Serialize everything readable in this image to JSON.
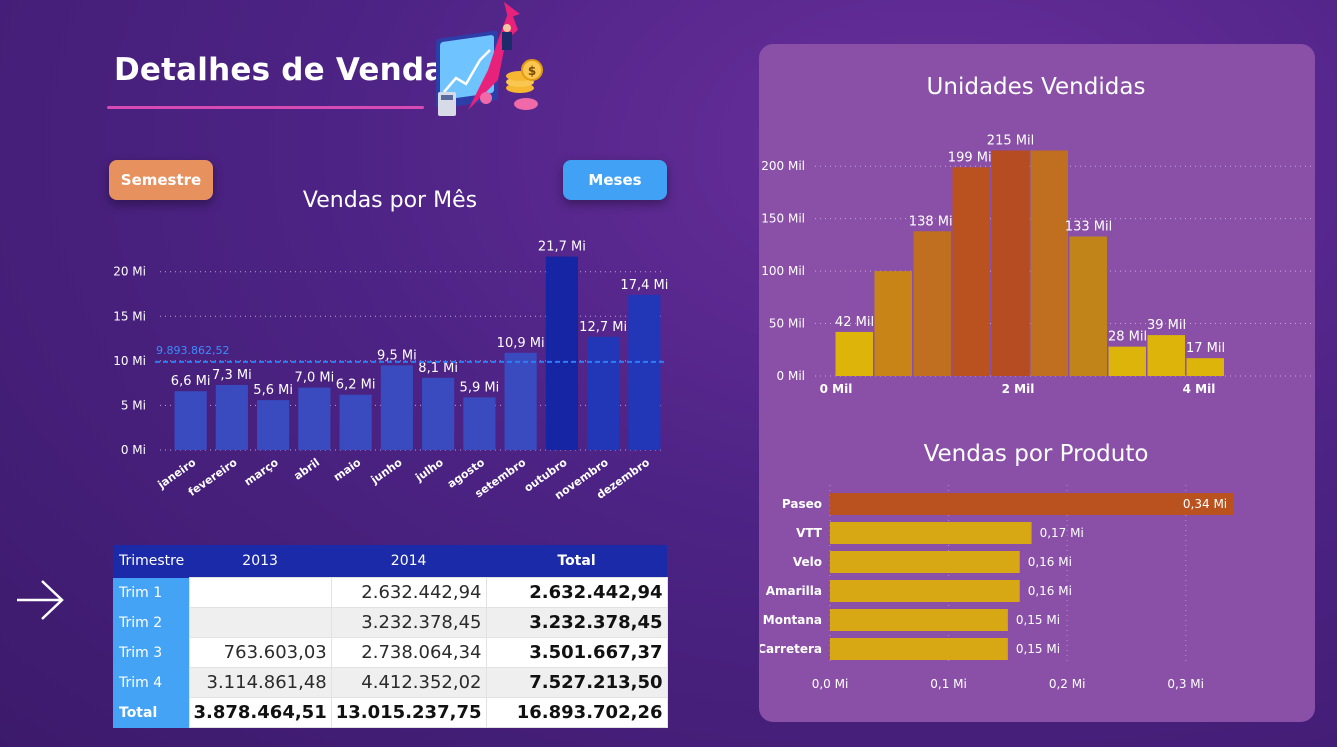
{
  "header": {
    "title": "Detalhes de Vendas"
  },
  "buttons": {
    "semestre": "Semestre",
    "meses": "Meses"
  },
  "charts": {
    "vendas_mes_title": "Vendas por Mês",
    "unidades_title": "Unidades Vendidas",
    "produto_title": "Vendas por Produto"
  },
  "colors": {
    "accent_bar": "#3a4abf",
    "highlight_bar": "#1525a3",
    "avg_line": "#2b7df5",
    "button_semestre": "#e7915f",
    "button_meses": "#41a2f5",
    "panel": "#8a50a8"
  },
  "chart_data": [
    {
      "id": "vendas_por_mes",
      "type": "bar",
      "title": "Vendas por Mês",
      "categories": [
        "janeiro",
        "fevereiro",
        "março",
        "abril",
        "maio",
        "junho",
        "julho",
        "agosto",
        "setembro",
        "outubro",
        "novembro",
        "dezembro"
      ],
      "values": [
        6.6,
        7.3,
        5.6,
        7.0,
        6.2,
        9.5,
        8.1,
        5.9,
        10.9,
        21.7,
        12.7,
        17.4
      ],
      "labels": [
        "6,6 Mi",
        "7,3 Mi",
        "5,6 Mi",
        "7,0 Mi",
        "6,2 Mi",
        "9,5 Mi",
        "8,1 Mi",
        "5,9 Mi",
        "10,9 Mi",
        "21,7 Mi",
        "12,7 Mi",
        "17,4 Mi"
      ],
      "unit": "Mi",
      "yticks": [
        "0 Mi",
        "5 Mi",
        "10 Mi",
        "15 Mi",
        "20 Mi"
      ],
      "ylim": [
        0,
        23
      ],
      "average_line": {
        "value": 9.89386252,
        "label": "9.893.862,52"
      },
      "grid": true
    },
    {
      "id": "unidades_vendidas",
      "type": "bar",
      "title": "Unidades Vendidas",
      "values": [
        42,
        100,
        138,
        199,
        215,
        215,
        133,
        28,
        39,
        17
      ],
      "labels": [
        "42 Mil",
        "",
        "138 Mil",
        "199 Mil",
        "215 Mil",
        "",
        "133 Mil",
        "28 Mil",
        "39 Mil",
        "17 Mil"
      ],
      "yticks": [
        "0 Mil",
        "50 Mil",
        "100 Mil",
        "150 Mil",
        "200 Mil"
      ],
      "xticks": [
        "0 Mil",
        "2 Mil",
        "4 Mil"
      ],
      "ylim": [
        0,
        225
      ],
      "grid": true
    },
    {
      "id": "vendas_por_produto",
      "type": "bar",
      "orientation": "horizontal",
      "title": "Vendas por Produto",
      "categories": [
        "Paseo",
        "VTT",
        "Velo",
        "Amarilla",
        "Montana",
        "Carretera"
      ],
      "values": [
        0.34,
        0.17,
        0.16,
        0.16,
        0.15,
        0.15
      ],
      "labels": [
        "0,34 Mi",
        "0,17 Mi",
        "0,16 Mi",
        "0,16 Mi",
        "0,15 Mi",
        "0,15 Mi"
      ],
      "xticks": [
        "0,0 Mi",
        "0,1 Mi",
        "0,2 Mi",
        "0,3 Mi"
      ],
      "xlim": [
        0,
        0.35
      ],
      "grid": true
    }
  ],
  "matrix": {
    "headers": [
      "Trimestre",
      "2013",
      "2014",
      "Total"
    ],
    "rows": [
      {
        "label": "Trim 1",
        "v2013": "",
        "v2014": "2.632.442,94",
        "total": "2.632.442,94"
      },
      {
        "label": "Trim 2",
        "v2013": "",
        "v2014": "3.232.378,45",
        "total": "3.232.378,45"
      },
      {
        "label": "Trim 3",
        "v2013": "763.603,03",
        "v2014": "2.738.064,34",
        "total": "3.501.667,37"
      },
      {
        "label": "Trim 4",
        "v2013": "3.114.861,48",
        "v2014": "4.412.352,02",
        "total": "7.527.213,50"
      }
    ],
    "total_row": {
      "label": "Total",
      "v2013": "3.878.464,51",
      "v2014": "13.015.237,75",
      "total": "16.893.702,26"
    }
  },
  "icons": {
    "illustration": "sales-growth-illustration",
    "arrow": "arrow-right-icon"
  }
}
